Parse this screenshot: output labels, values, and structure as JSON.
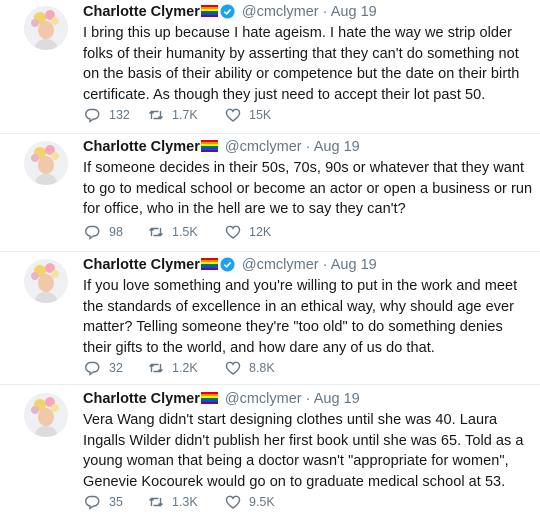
{
  "colors": {
    "verified": "#1da1f2",
    "muted": "#657786",
    "text": "#14171a",
    "divider": "#e6ecf0"
  },
  "flag_colors": [
    "#e40303",
    "#ff8c00",
    "#ffed00",
    "#008026",
    "#004dff",
    "#750787"
  ],
  "tweets": [
    {
      "name": "Charlotte Clymer",
      "handle": "@cmclymer",
      "separator": "·",
      "date": "Aug 19",
      "verified": true,
      "text": "I bring this up because I hate ageism. I hate the way we strip older folks of their humanity by asserting that they can't do something not on the basis of their ability or competence but the date on their birth certificate. As though they just need to accept their lot past 50.",
      "replies": "132",
      "retweets": "1.7K",
      "likes": "15K"
    },
    {
      "name": "Charlotte Clymer",
      "handle": "@cmclymer",
      "separator": "·",
      "date": "Aug 19",
      "verified": false,
      "text": "If someone decides in their 50s, 70s, 90s or whatever that they want to go to medical school or become an actor or open a business or run for office, who in the hell are we to say they can't?",
      "replies": "98",
      "retweets": "1.5K",
      "likes": "12K"
    },
    {
      "name": "Charlotte Clymer",
      "handle": "@cmclymer",
      "separator": "·",
      "date": "Aug 19",
      "verified": true,
      "text": "If you love something and you're willing to put in the work and meet the standards of excellence in an ethical way, why should age ever matter? Telling someone they're \"too old\" to do something denies their gifts to the world, and how dare any of us do that.",
      "replies": "32",
      "retweets": "1.2K",
      "likes": "8.8K"
    },
    {
      "name": "Charlotte Clymer",
      "handle": "@cmclymer",
      "separator": "·",
      "date": "Aug 19",
      "verified": false,
      "text": "Vera Wang didn't start designing clothes until she was 40. Laura Ingalls Wilder didn't publish her first book until she was 65. Told as a young woman that being a doctor wasn't \"appropriate for women\", Genevie Kocourek would go on to graduate medical school at 53.",
      "replies": "35",
      "retweets": "1.3K",
      "likes": "9.5K"
    }
  ]
}
